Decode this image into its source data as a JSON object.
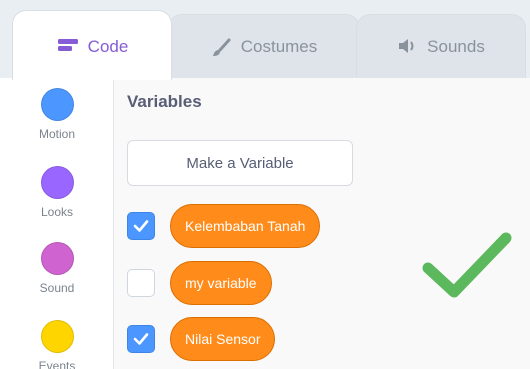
{
  "tabs": [
    {
      "label": "Code",
      "icon": "code-icon",
      "active": true
    },
    {
      "label": "Costumes",
      "icon": "brush-icon",
      "active": false
    },
    {
      "label": "Sounds",
      "icon": "speaker-icon",
      "active": false
    }
  ],
  "categories": [
    {
      "label": "Motion",
      "color": "#4c97ff"
    },
    {
      "label": "Looks",
      "color": "#9966ff"
    },
    {
      "label": "Sound",
      "color": "#cf63cf"
    },
    {
      "label": "Events",
      "color": "#ffd500"
    }
  ],
  "palette": {
    "section_title": "Variables",
    "make_variable_label": "Make a Variable",
    "variables": [
      {
        "label": "Kelembaban Tanah",
        "checked": true
      },
      {
        "label": "my variable",
        "checked": false
      },
      {
        "label": "Nilai Sensor",
        "checked": true
      }
    ]
  },
  "colors": {
    "accent": "#855cd6",
    "variable_block": "#ff8c1a",
    "checkbox_on": "#4c97ff",
    "big_check": "#5cb85c"
  },
  "overlay": {
    "icon": "big-green-checkmark-icon"
  }
}
